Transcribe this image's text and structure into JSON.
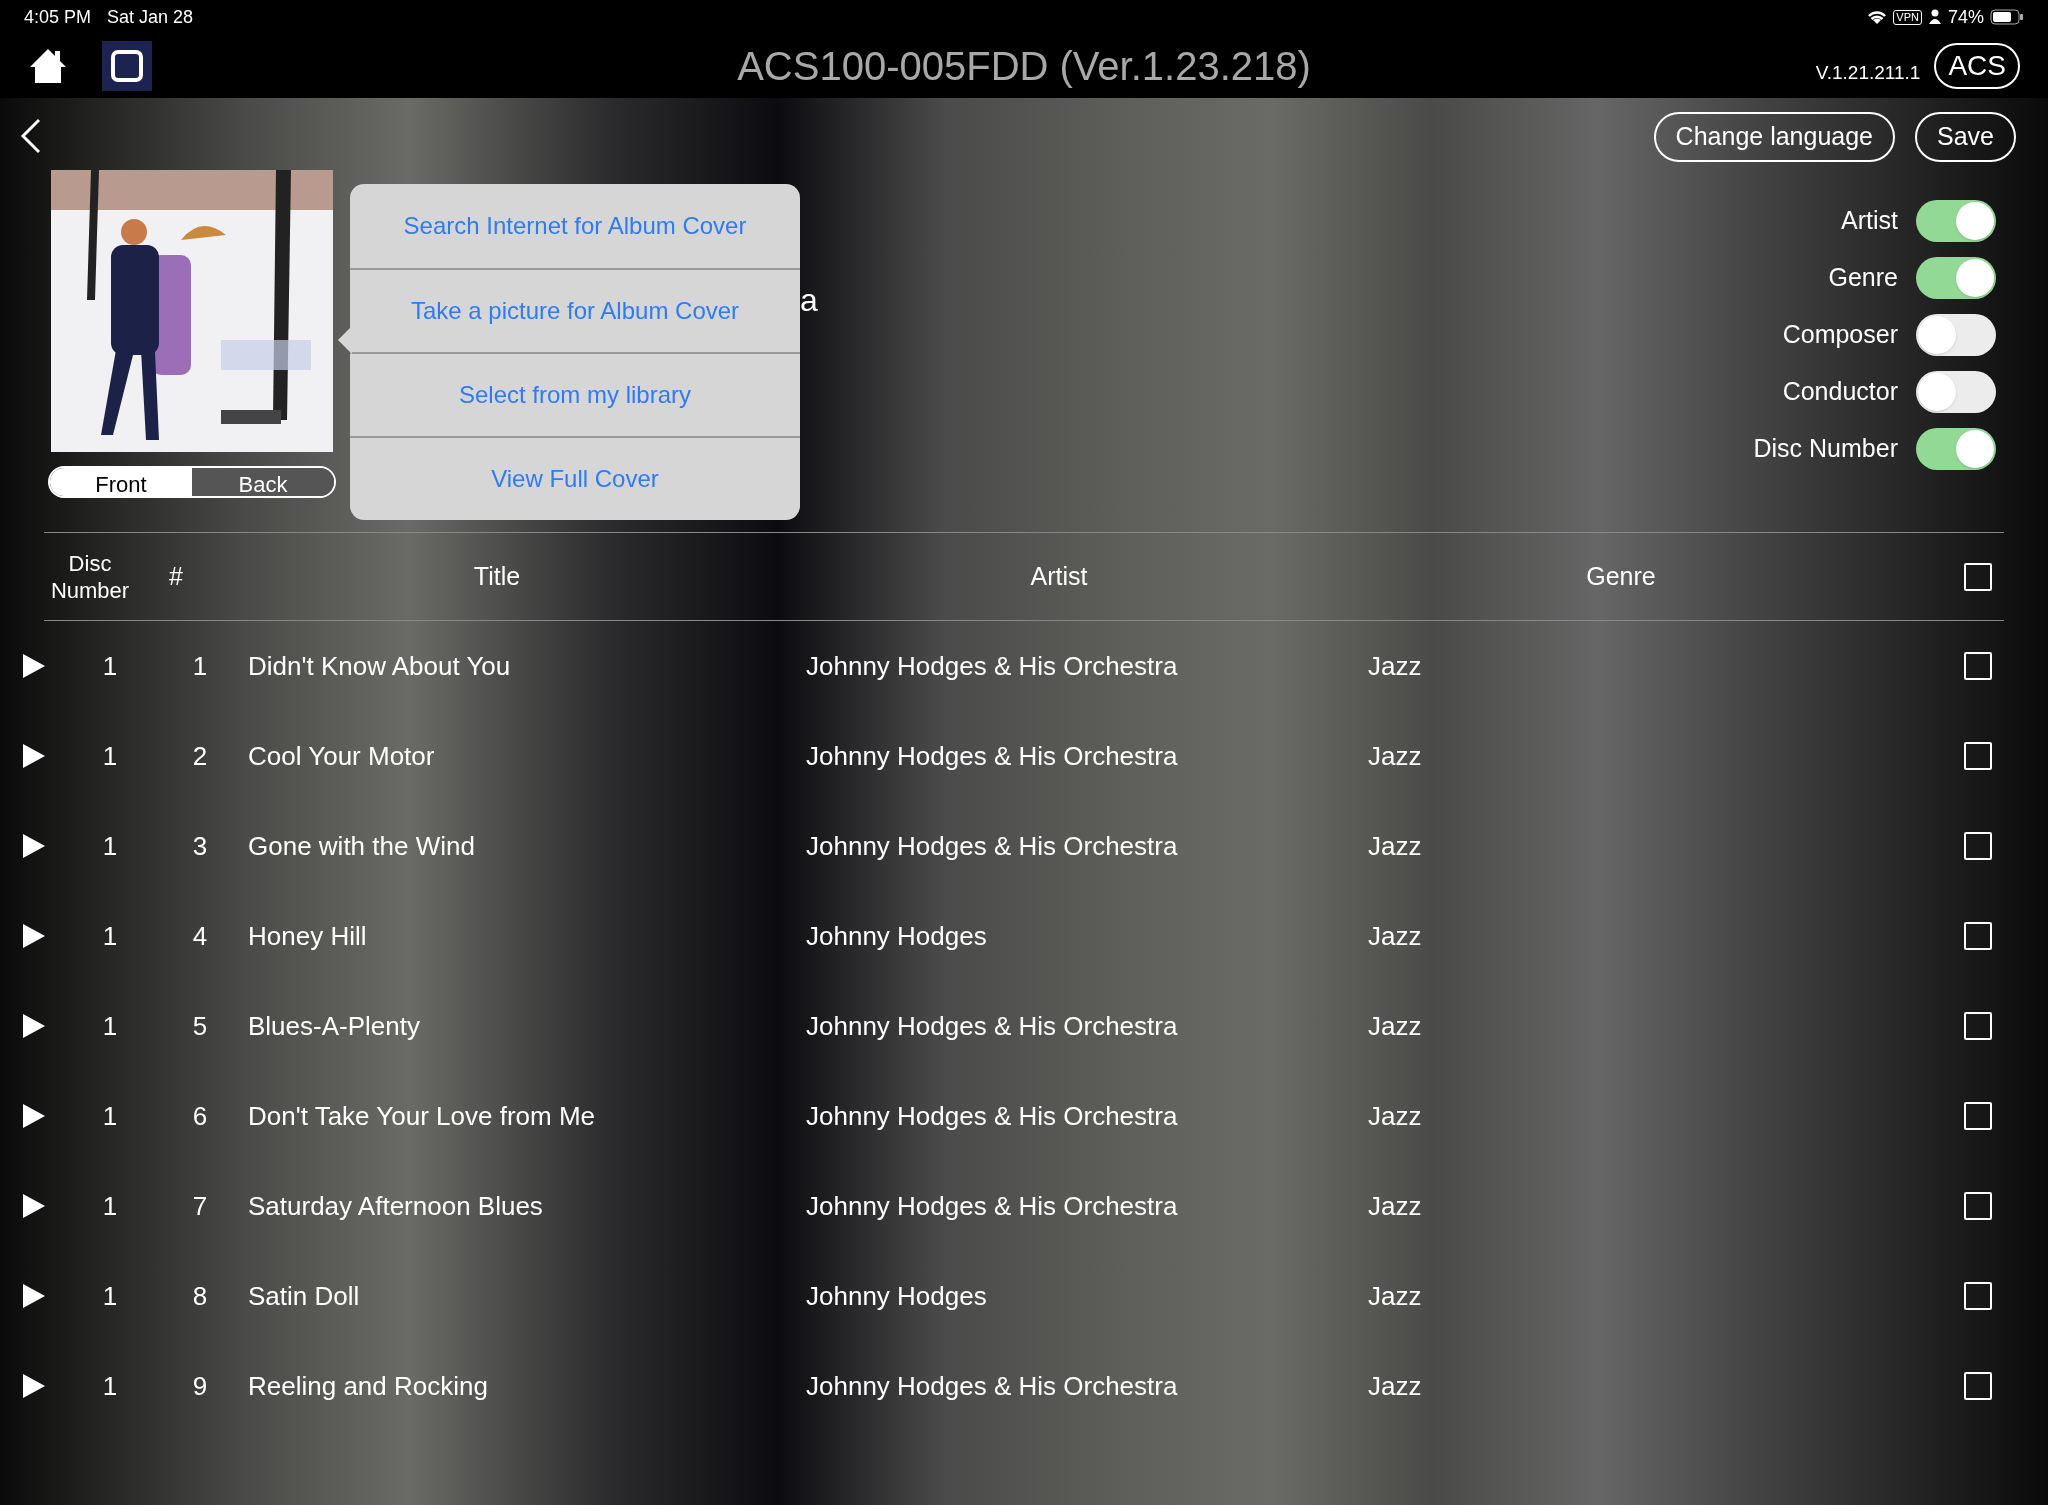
{
  "status_bar": {
    "time": "4:05 PM",
    "date": "Sat Jan 28",
    "vpn": "VPN",
    "battery_text": "74%"
  },
  "title_bar": {
    "title": "ACS100-005FDD (Ver.1.23.218)",
    "version": "V.1.21.211.1",
    "badge": "ACS"
  },
  "actions": [
    "Change language",
    "Save"
  ],
  "cover": {
    "kind": "picture",
    "sides": [
      {
        "label": "Front",
        "selected": true
      },
      {
        "label": "Back",
        "selected": false
      }
    ]
  },
  "popover": {
    "items": [
      "Search Internet for Album Cover",
      "Take a picture for Album Cover",
      "Select from my library",
      "View Full Cover"
    ],
    "obscured_text": "a"
  },
  "toggles": [
    {
      "label": "Artist",
      "on": true
    },
    {
      "label": "Genre",
      "on": true
    },
    {
      "label": "Composer",
      "on": false
    },
    {
      "label": "Conductor",
      "on": false
    },
    {
      "label": "Disc Number",
      "on": true
    }
  ],
  "table": {
    "columns": [
      "Disc\nNumber",
      "#",
      "Title",
      "Artist",
      "Genre"
    ],
    "header_checked": false,
    "rows": [
      {
        "disc": "1",
        "number": "1",
        "title": "Didn't Know About You",
        "artist": "Johnny Hodges & His Orchestra",
        "genre": "Jazz",
        "checked": false
      },
      {
        "disc": "1",
        "number": "2",
        "title": "Cool Your Motor",
        "artist": "Johnny Hodges & His Orchestra",
        "genre": "Jazz",
        "checked": false
      },
      {
        "disc": "1",
        "number": "3",
        "title": "Gone with the Wind",
        "artist": "Johnny Hodges & His Orchestra",
        "genre": "Jazz",
        "checked": false
      },
      {
        "disc": "1",
        "number": "4",
        "title": "Honey Hill",
        "artist": "Johnny Hodges",
        "genre": "Jazz",
        "checked": false
      },
      {
        "disc": "1",
        "number": "5",
        "title": "Blues-A-Plenty",
        "artist": "Johnny Hodges & His Orchestra",
        "genre": "Jazz",
        "checked": false
      },
      {
        "disc": "1",
        "number": "6",
        "title": "Don't Take Your Love from Me",
        "artist": "Johnny Hodges & His Orchestra",
        "genre": "Jazz",
        "checked": false
      },
      {
        "disc": "1",
        "number": "7",
        "title": "Saturday Afternoon Blues",
        "artist": "Johnny Hodges & His Orchestra",
        "genre": "Jazz",
        "checked": false
      },
      {
        "disc": "1",
        "number": "8",
        "title": "Satin Doll",
        "artist": "Johnny Hodges",
        "genre": "Jazz",
        "checked": false
      },
      {
        "disc": "1",
        "number": "9",
        "title": "Reeling and Rocking",
        "artist": "Johnny Hodges & His Orchestra",
        "genre": "Jazz",
        "checked": false
      }
    ]
  }
}
